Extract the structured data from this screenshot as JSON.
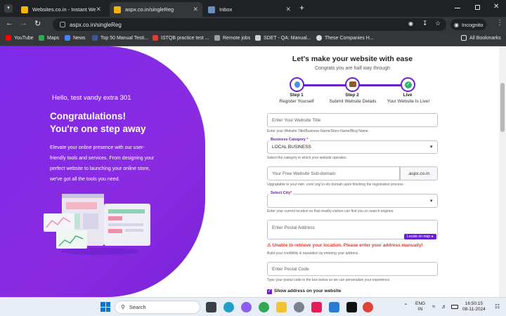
{
  "browser": {
    "tabs": [
      {
        "title": "Websites.co.in - Instant Website",
        "active": false
      },
      {
        "title": "aspx.co.in/singleReg",
        "active": true
      },
      {
        "title": "Inbox",
        "active": false
      }
    ],
    "new_tab": "+",
    "url": "aspx.co.in/singleReg",
    "incognito_label": "Incognito",
    "bookmarks": [
      "YouTube",
      "Maps",
      "News",
      "Top 50 Manual Testi...",
      "ISTQB practice test ...",
      "Remote jobs",
      "SDET - QA: Manual...",
      "These Companies H..."
    ],
    "all_bookmarks": "All Bookmarks"
  },
  "hero": {
    "greeting": "Hello, test vandy extra 301",
    "headline_1": "Congratulations!",
    "headline_2": "You're one step away",
    "body": "Elevate your online presence with our user-friendly tools and services. From designing your perfect website to launching your online store, we've got all the tools you need."
  },
  "form": {
    "heading": "Let's make your website with ease",
    "subheading": "Congrats you are half way through",
    "steps": [
      {
        "title": "Step 1",
        "label": "Register Yourself"
      },
      {
        "title": "Step 2",
        "label": "Submit Website Details"
      },
      {
        "title": "Live",
        "label": "Your Website Is Live!"
      }
    ],
    "website_title": {
      "placeholder": "Enter Your Website Title",
      "help": "Enter your Website Title/Business Name/Store Name/Blog Name."
    },
    "category": {
      "label": "Business Category",
      "required": "*",
      "value": "LOCAL BUSINESS",
      "help": "Select the category in which your website operates."
    },
    "subdomain": {
      "placeholder": "Your Free Website Sub-domain",
      "suffix": ".aspx.co.in",
      "help": "Upgradable to your own .com/.org/.in etc domain upon finishing the registration process."
    },
    "city": {
      "label": "Select City",
      "required": "*",
      "help": "Enter your current location so that nearby visitors can find you on search engines."
    },
    "address": {
      "placeholder": "Enter Postal Address",
      "map_button": "Locate on map",
      "error": "Unable to retrieve your location. Please enter your address manually!",
      "help": "Build your credibility & reputation by entering your address."
    },
    "postal_code": {
      "placeholder": "Enter Postal Code",
      "help": "Type your postal code in the box below so we can personalize your experience."
    },
    "show_address": {
      "label": "Show address on your website",
      "checked": true
    }
  },
  "taskbar": {
    "search_label": "Search",
    "language": "ENG",
    "region": "IN",
    "time": "16:50:15",
    "date": "08-11-2024"
  },
  "colors": {
    "purple": "#7d2ae8",
    "error": "#e53935",
    "chrome_dark": "#202124"
  }
}
